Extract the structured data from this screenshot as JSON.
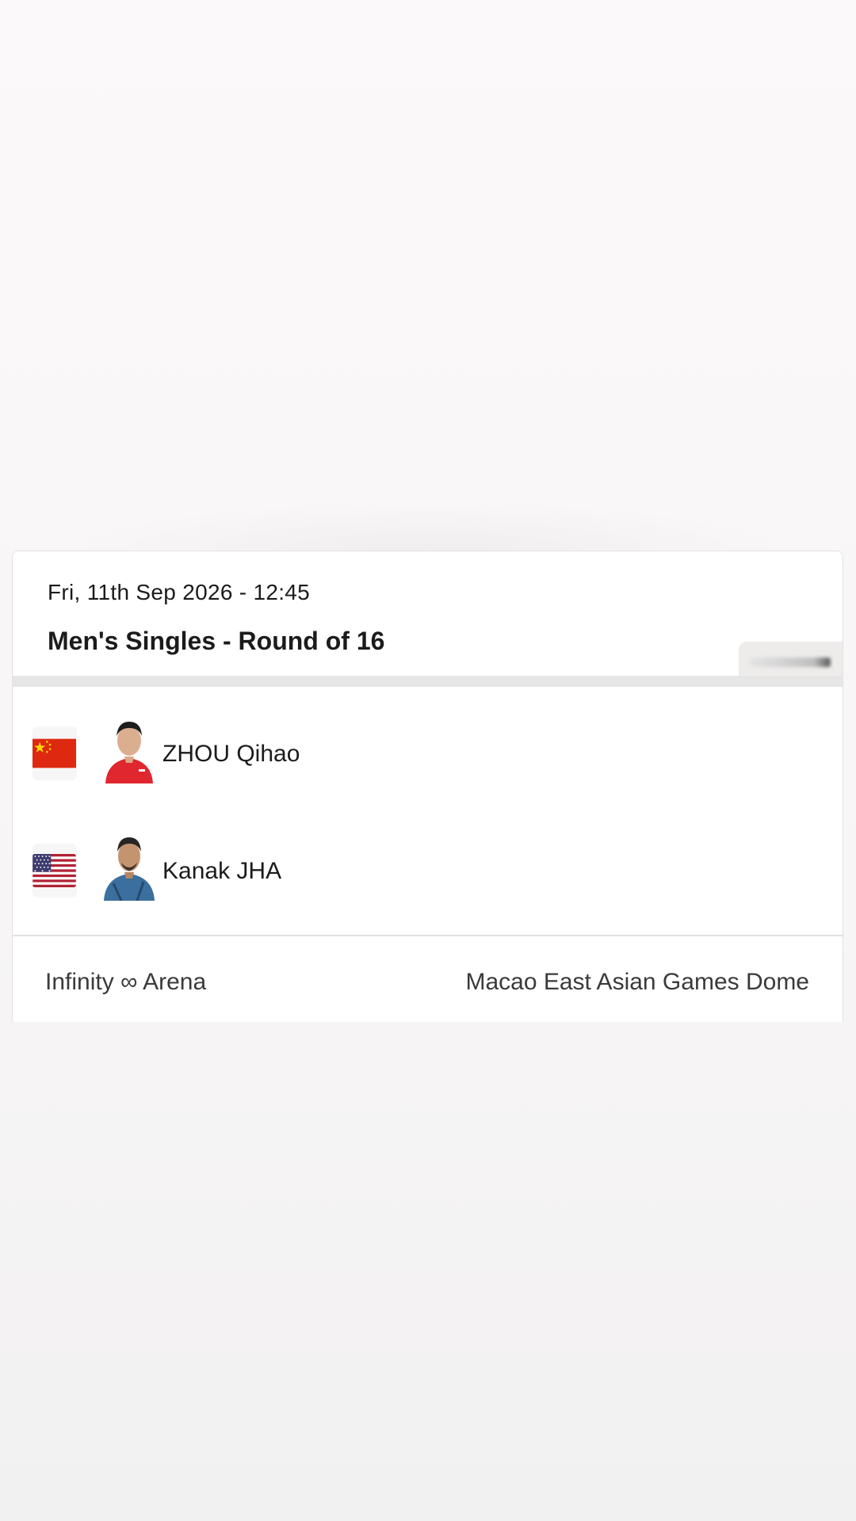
{
  "match": {
    "datetime": "Fri, 11th Sep 2026 - 12:45",
    "event": "Men's Singles - Round of 16"
  },
  "players": [
    {
      "name": "ZHOU Qihao",
      "country_flag": "china-flag",
      "flag_color": "#de2910",
      "jersey_color": "#e0262e"
    },
    {
      "name": "Kanak JHA",
      "country_flag": "usa-flag",
      "flag_color": "#3c3b6e",
      "jersey_color": "#3a6f9e"
    }
  ],
  "venue": {
    "arena": "Infinity ∞ Arena",
    "location": "Macao East Asian Games Dome"
  },
  "colors": {
    "card_bg": "#ffffff",
    "text": "#1b1b1b",
    "divider": "#e6e6e6"
  }
}
